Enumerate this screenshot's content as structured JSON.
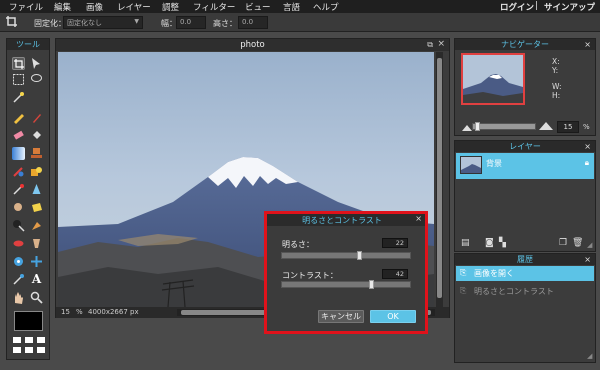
{
  "menu": {
    "items": [
      "ファイル",
      "編集",
      "画像",
      "レイヤー",
      "調整",
      "フィルター",
      "ビュー",
      "言語",
      "ヘルプ"
    ],
    "login": "ログイン",
    "separator": "|",
    "signup": "サインアップ"
  },
  "options": {
    "fixed_label": "固定化：",
    "fixed_value": "固定化なし",
    "width_label": "幅：",
    "width_value": "0.0",
    "height_label": "高さ：",
    "height_value": "0.0"
  },
  "tools": {
    "title": "ツール"
  },
  "photo": {
    "title": "photo",
    "zoom": "15",
    "zoom_unit": "%",
    "size": "4000x2667 px"
  },
  "dialog": {
    "title": "明るさとコントラスト",
    "brightness_label": "明るさ：",
    "brightness_value": "22",
    "brightness_level": 0.61,
    "contrast_label": "コントラスト：",
    "contrast_value": "42",
    "contrast_level": 0.71,
    "cancel": "キャンセル",
    "ok": "OK"
  },
  "navigator": {
    "title": "ナビゲーター",
    "x": "X:",
    "y": "Y:",
    "w": "W:",
    "h": "H:",
    "zoom": "15",
    "unit": "%"
  },
  "layers": {
    "title": "レイヤー",
    "background": "背景"
  },
  "history": {
    "title": "履歴",
    "items": [
      "画像を開く",
      "明るさとコントラスト"
    ]
  },
  "colors": {
    "accent": "#5cc3e6",
    "dialog_border": "#e0121b",
    "selected_row": "#5cc3e6"
  }
}
